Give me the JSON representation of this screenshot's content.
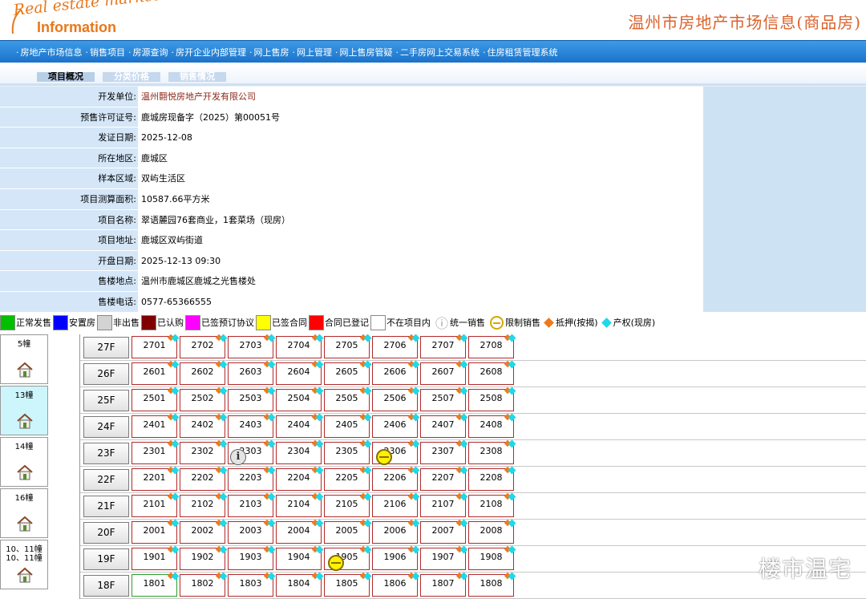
{
  "header": {
    "logo_line1": "Real estate market",
    "logo_line2": "Information",
    "site_title": "温州市房地产市场信息(商品房)"
  },
  "nav": [
    "房地产市场信息",
    "销售项目",
    "房源查询",
    "房开企业内部管理",
    "网上售房",
    "网上管理",
    "网上售房管疑",
    "二手房网上交易系统",
    "住房租赁管理系统"
  ],
  "tabs": {
    "overview": "项目概况",
    "price": "分类价格",
    "sales": "销售情况"
  },
  "info": [
    {
      "label": "开发单位:",
      "value": "温州翾悦房地产开发有限公司",
      "link": true
    },
    {
      "label": "预售许可证号:",
      "value": "鹿城房现备字（2025）第00051号"
    },
    {
      "label": "发证日期:",
      "value": "2025-12-08"
    },
    {
      "label": "所在地区:",
      "value": "鹿城区"
    },
    {
      "label": "样本区域:",
      "value": "双屿生活区"
    },
    {
      "label": "项目测算面积:",
      "value": "10587.66平方米"
    },
    {
      "label": "项目名称:",
      "value": "翠语麓园76套商业，1套菜场（现房）"
    },
    {
      "label": "项目地址:",
      "value": "鹿城区双屿街道"
    },
    {
      "label": "开盘日期:",
      "value": "2025-12-13 09:30"
    },
    {
      "label": "售楼地点:",
      "value": "温州市鹿城区鹿城之光售楼处"
    },
    {
      "label": "售楼电话:",
      "value": "0577-65366555"
    }
  ],
  "legend": [
    {
      "label": "正常发售",
      "color": "#00c000"
    },
    {
      "label": "安置房",
      "color": "#0000ff"
    },
    {
      "label": "非出售",
      "color": "#d3d3d3"
    },
    {
      "label": "已认购",
      "color": "#800000"
    },
    {
      "label": "已签预订协议",
      "color": "#ff00ff"
    },
    {
      "label": "已签合同",
      "color": "#ffff00"
    },
    {
      "label": "合同已登记",
      "color": "#ff0000"
    },
    {
      "label": "不在项目内",
      "color": "#ffffff"
    }
  ],
  "legend_icons": {
    "unified": "统一销售",
    "limited": "限制销售",
    "mortgage": "抵押(按揭)",
    "property": "产权(现房)"
  },
  "buildings": [
    {
      "name": "5幢"
    },
    {
      "name": "13幢",
      "active": true
    },
    {
      "name": "14幢"
    },
    {
      "name": "16幢"
    },
    {
      "name": "10、11幢\n10、11幢"
    }
  ],
  "floors": [
    {
      "label": "27F",
      "units": [
        "2701",
        "2702",
        "2703",
        "2704",
        "2705",
        "2706",
        "2707",
        "2708"
      ]
    },
    {
      "label": "26F",
      "units": [
        "2601",
        "2602",
        "2603",
        "2604",
        "2605",
        "2606",
        "2607",
        "2608"
      ]
    },
    {
      "label": "25F",
      "units": [
        "2501",
        "2502",
        "2503",
        "2504",
        "2505",
        "2506",
        "2507",
        "2508"
      ]
    },
    {
      "label": "24F",
      "units": [
        "2401",
        "2402",
        "2403",
        "2404",
        "2405",
        "2406",
        "2407",
        "2408"
      ]
    },
    {
      "label": "23F",
      "units": [
        "2301",
        "2302",
        "2303",
        "2304",
        "2305",
        "2306",
        "2307",
        "2308"
      ]
    },
    {
      "label": "22F",
      "units": [
        "2201",
        "2202",
        "2203",
        "2204",
        "2205",
        "2206",
        "2207",
        "2208"
      ]
    },
    {
      "label": "21F",
      "units": [
        "2101",
        "2102",
        "2103",
        "2104",
        "2105",
        "2106",
        "2107",
        "2108"
      ]
    },
    {
      "label": "20F",
      "units": [
        "2001",
        "2002",
        "2003",
        "2004",
        "2005",
        "2006",
        "2007",
        "2008"
      ]
    },
    {
      "label": "19F",
      "units": [
        "1901",
        "1902",
        "1903",
        "1904",
        "1905",
        "1906",
        "1907",
        "1908"
      ]
    },
    {
      "label": "18F",
      "units": [
        "1801",
        "1802",
        "1803",
        "1804",
        "1805",
        "1806",
        "1807",
        "1808"
      ]
    }
  ],
  "watermark": "楼市温宅"
}
